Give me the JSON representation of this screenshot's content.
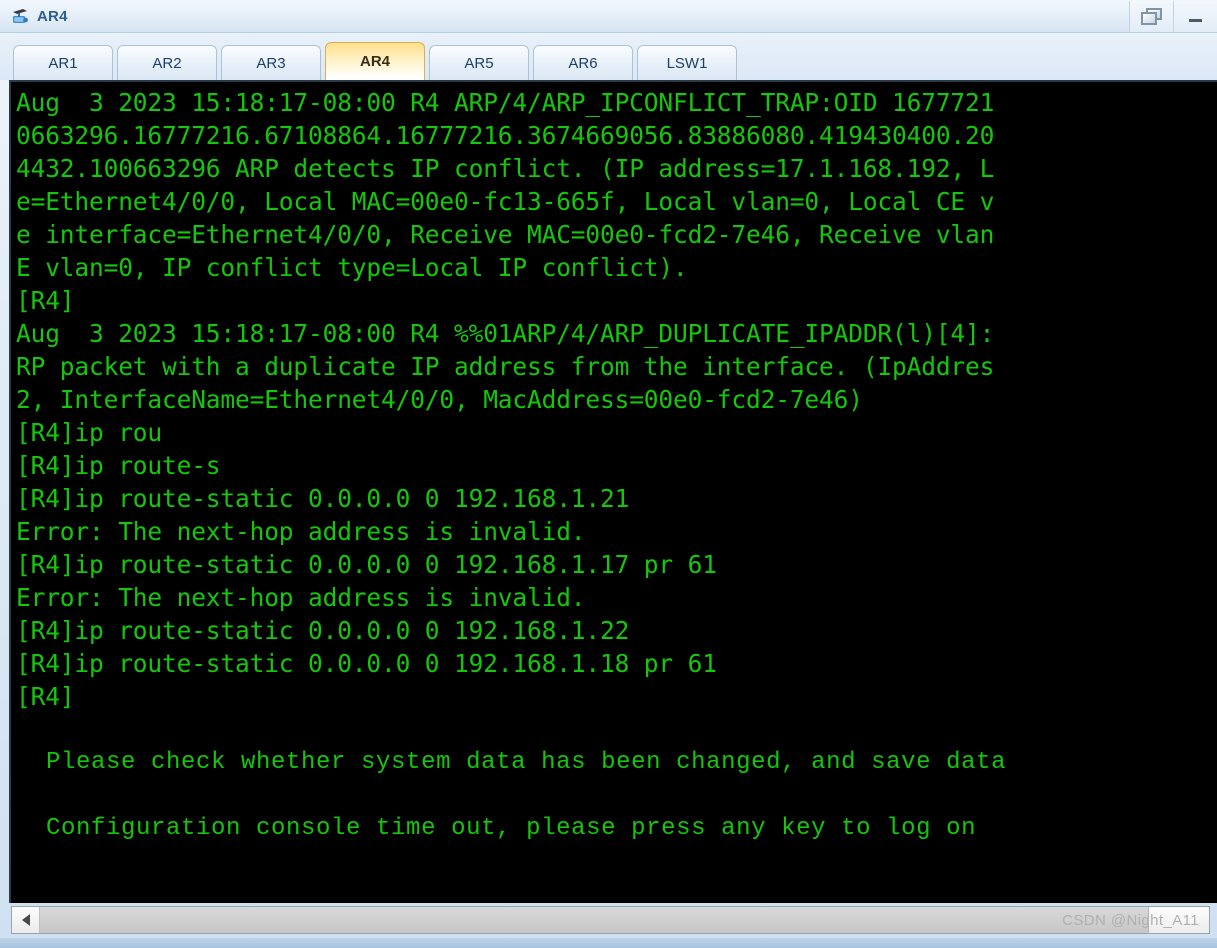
{
  "window": {
    "title": "AR4",
    "icon": "router-icon",
    "buttons": [
      {
        "name": "restore-button",
        "glyph": "restore-icon",
        "label": "Restore"
      },
      {
        "name": "minimize-button",
        "glyph": "minimize-icon",
        "label": "Minimize"
      }
    ]
  },
  "tabs": [
    {
      "label": "AR1",
      "active": false
    },
    {
      "label": "AR2",
      "active": false
    },
    {
      "label": "AR3",
      "active": false
    },
    {
      "label": "AR4",
      "active": true
    },
    {
      "label": "AR5",
      "active": false
    },
    {
      "label": "AR6",
      "active": false
    },
    {
      "label": "LSW1",
      "active": false
    }
  ],
  "terminal": {
    "foreground_color": "#16c60c",
    "background_color": "#000000",
    "lines": [
      {
        "text": "Aug  3 2023 15:18:17-08:00 R4 ARP/4/ARP_IPCONFLICT_TRAP:OID 1677721",
        "style": "normal"
      },
      {
        "text": "0663296.16777216.67108864.16777216.3674669056.83886080.419430400.20",
        "style": "normal"
      },
      {
        "text": "4432.100663296 ARP detects IP conflict. (IP address=17.1.168.192, L",
        "style": "normal"
      },
      {
        "text": "e=Ethernet4/0/0, Local MAC=00e0-fc13-665f, Local vlan=0, Local CE v",
        "style": "normal"
      },
      {
        "text": "e interface=Ethernet4/0/0, Receive MAC=00e0-fcd2-7e46, Receive vlan",
        "style": "normal"
      },
      {
        "text": "E vlan=0, IP conflict type=Local IP conflict).",
        "style": "normal"
      },
      {
        "text": "[R4]",
        "style": "normal"
      },
      {
        "text": "Aug  3 2023 15:18:17-08:00 R4 %%01ARP/4/ARP_DUPLICATE_IPADDR(l)[4]:",
        "style": "normal"
      },
      {
        "text": "RP packet with a duplicate IP address from the interface. (IpAddres",
        "style": "normal"
      },
      {
        "text": "2, InterfaceName=Ethernet4/0/0, MacAddress=00e0-fcd2-7e46)",
        "style": "normal"
      },
      {
        "text": "[R4]ip rou",
        "style": "normal"
      },
      {
        "text": "[R4]ip route-s",
        "style": "normal"
      },
      {
        "text": "[R4]ip route-static 0.0.0.0 0 192.168.1.21",
        "style": "normal"
      },
      {
        "text": "Error: The next-hop address is invalid.",
        "style": "normal"
      },
      {
        "text": "[R4]ip route-static 0.0.0.0 0 192.168.1.17 pr 61",
        "style": "normal"
      },
      {
        "text": "Error: The next-hop address is invalid.",
        "style": "normal"
      },
      {
        "text": "[R4]ip route-static 0.0.0.0 0 192.168.1.22",
        "style": "normal"
      },
      {
        "text": "[R4]ip route-static 0.0.0.0 0 192.168.1.18 pr 61",
        "style": "normal"
      },
      {
        "text": "[R4]",
        "style": "normal"
      },
      {
        "text": "",
        "style": "normal"
      },
      {
        "text": "  Please check whether system data has been changed, and save data",
        "style": "narrow"
      },
      {
        "text": "",
        "style": "narrow"
      },
      {
        "text": "  Configuration console time out, please press any key to log on",
        "style": "narrow"
      }
    ]
  },
  "scrollbar": {
    "left_arrow": "chevron-left-icon"
  },
  "watermark": {
    "text": "CSDN @Night_A11"
  }
}
